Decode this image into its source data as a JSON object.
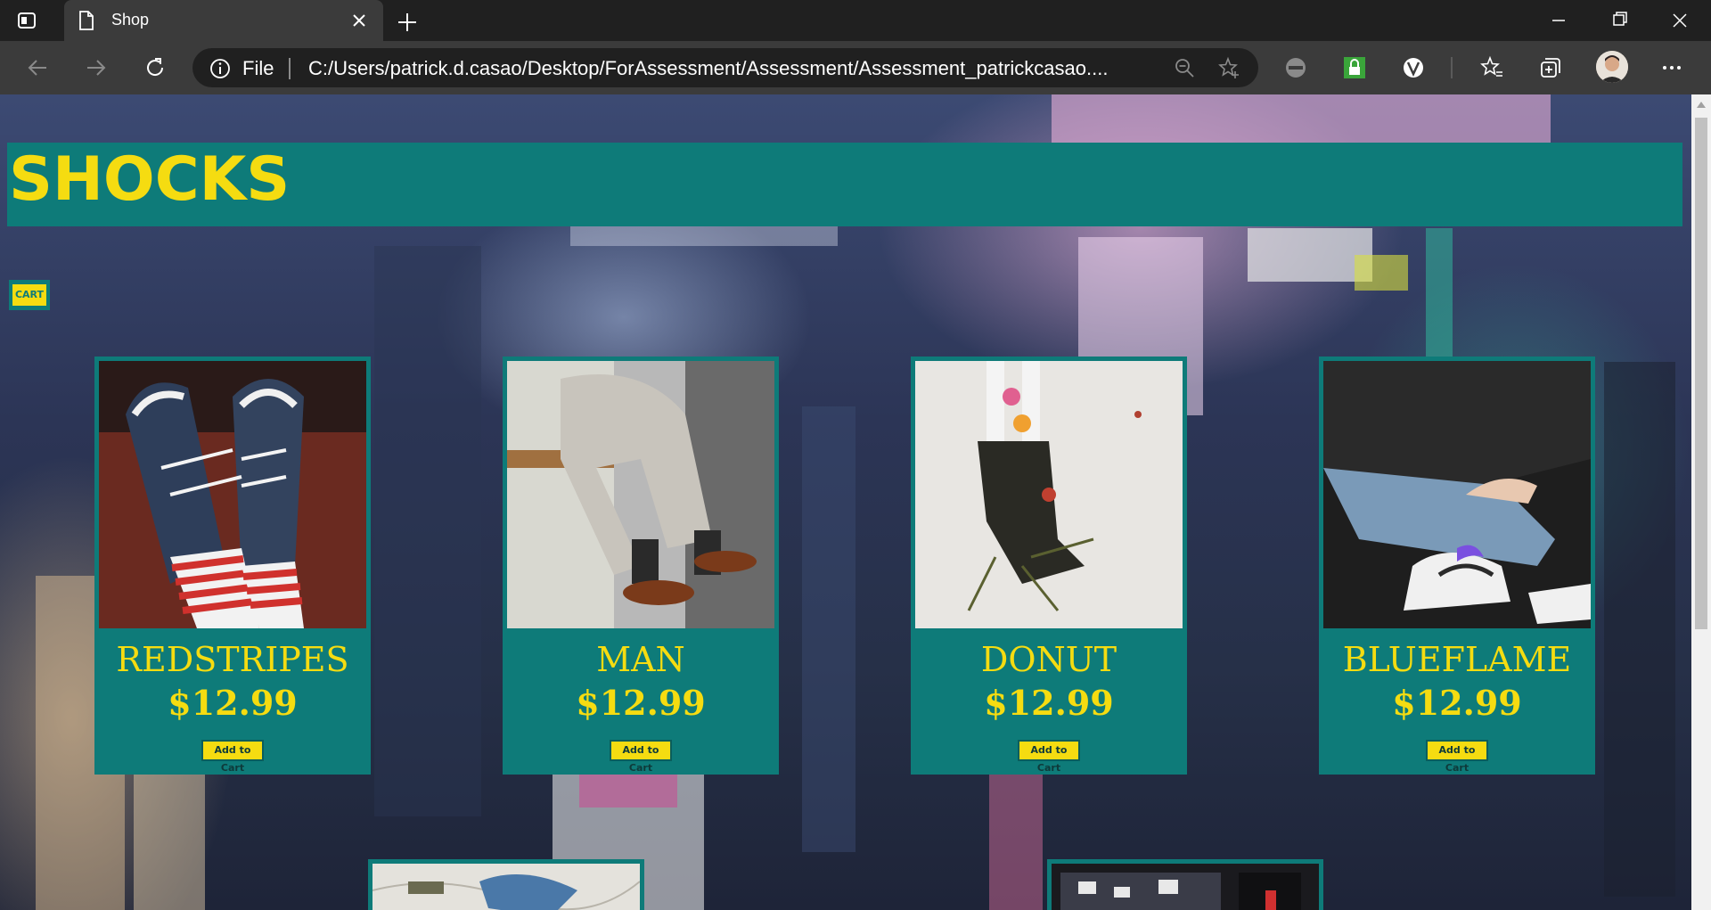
{
  "browser": {
    "tab_title": "Shop",
    "address_prefix": "File",
    "url": "C:/Users/patrick.d.casao/Desktop/ForAssessment/Assessment/Assessment_patrickcasao...."
  },
  "page": {
    "logo": "SHOCKS",
    "cart_label": "CART",
    "products": [
      {
        "name": "REDSTRIPES",
        "price": "$12.99",
        "button": "Add to Cart"
      },
      {
        "name": "MAN",
        "price": "$12.99",
        "button": "Add to Cart"
      },
      {
        "name": "DONUT",
        "price": "$12.99",
        "button": "Add to Cart"
      },
      {
        "name": "BLUEFLAME",
        "price": "$12.99",
        "button": "Add to Cart"
      }
    ]
  },
  "colors": {
    "teal": "#0e7b79",
    "yellow": "#f5dc11",
    "chrome_dark": "#202020",
    "chrome_mid": "#3b3b3b"
  }
}
